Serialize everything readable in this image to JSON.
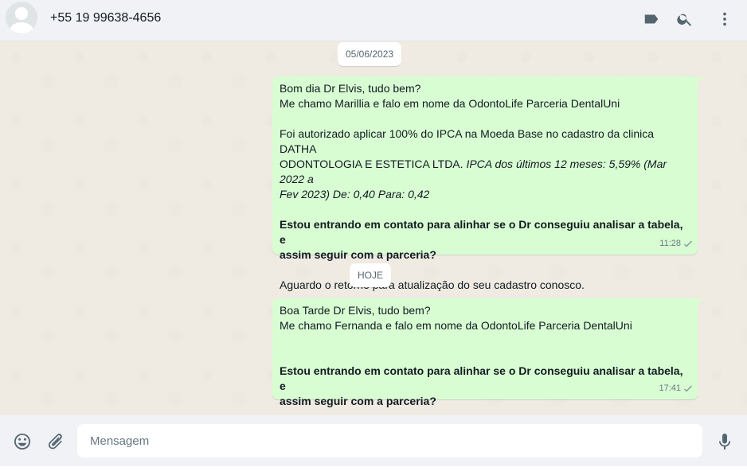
{
  "header": {
    "contact_name": "+55 19 99638-4656",
    "icons": [
      "label-icon",
      "search-icon",
      "menu-icon"
    ]
  },
  "chat": {
    "date_separators": [
      "05/06/2023",
      "HOJE"
    ],
    "messages": [
      {
        "lines": [
          "Bom dia Dr Elvis, tudo bem?",
          "Me chamo Marillia e falo em nome da OdontoLife Parceria DentalUni",
          "",
          "Foi autorizado aplicar 100% do IPCA na Moeda Base no cadastro da clinica DATHA",
          "ODONTOLOGIA E ESTETICA LTDA.",
          "IPCA dos últimos 12 meses: 5,59% (Mar 2022 a",
          "Fev 2023) De: 0,40 Para: 0,42",
          "",
          "Estou entrando em contato para alinhar se o Dr conseguiu analisar a tabela, e",
          "assim seguir com a parceria?",
          "",
          "Aguardo o retorno para atualização do seu cadastro conosco."
        ],
        "time": "11:28",
        "status": "sent-check-icon"
      },
      {
        "lines": [
          "Boa Tarde Dr Elvis, tudo bem?",
          "Me chamo Fernanda e falo em nome da OdontoLife Parceria DentalUni",
          "",
          "",
          "Estou entrando em contato para alinhar se o Dr conseguiu analisar a tabela, e",
          "assim seguir com a parceria?"
        ],
        "time": "17:41",
        "status": "sent-check-icon"
      }
    ]
  },
  "footer": {
    "input_placeholder": "Mensagem",
    "input_value": ""
  },
  "colors": {
    "bubble_out": "#d9fdd3",
    "chat_bg": "#efeae2",
    "header_bg": "#f0f2f5",
    "icon": "#54656f"
  }
}
